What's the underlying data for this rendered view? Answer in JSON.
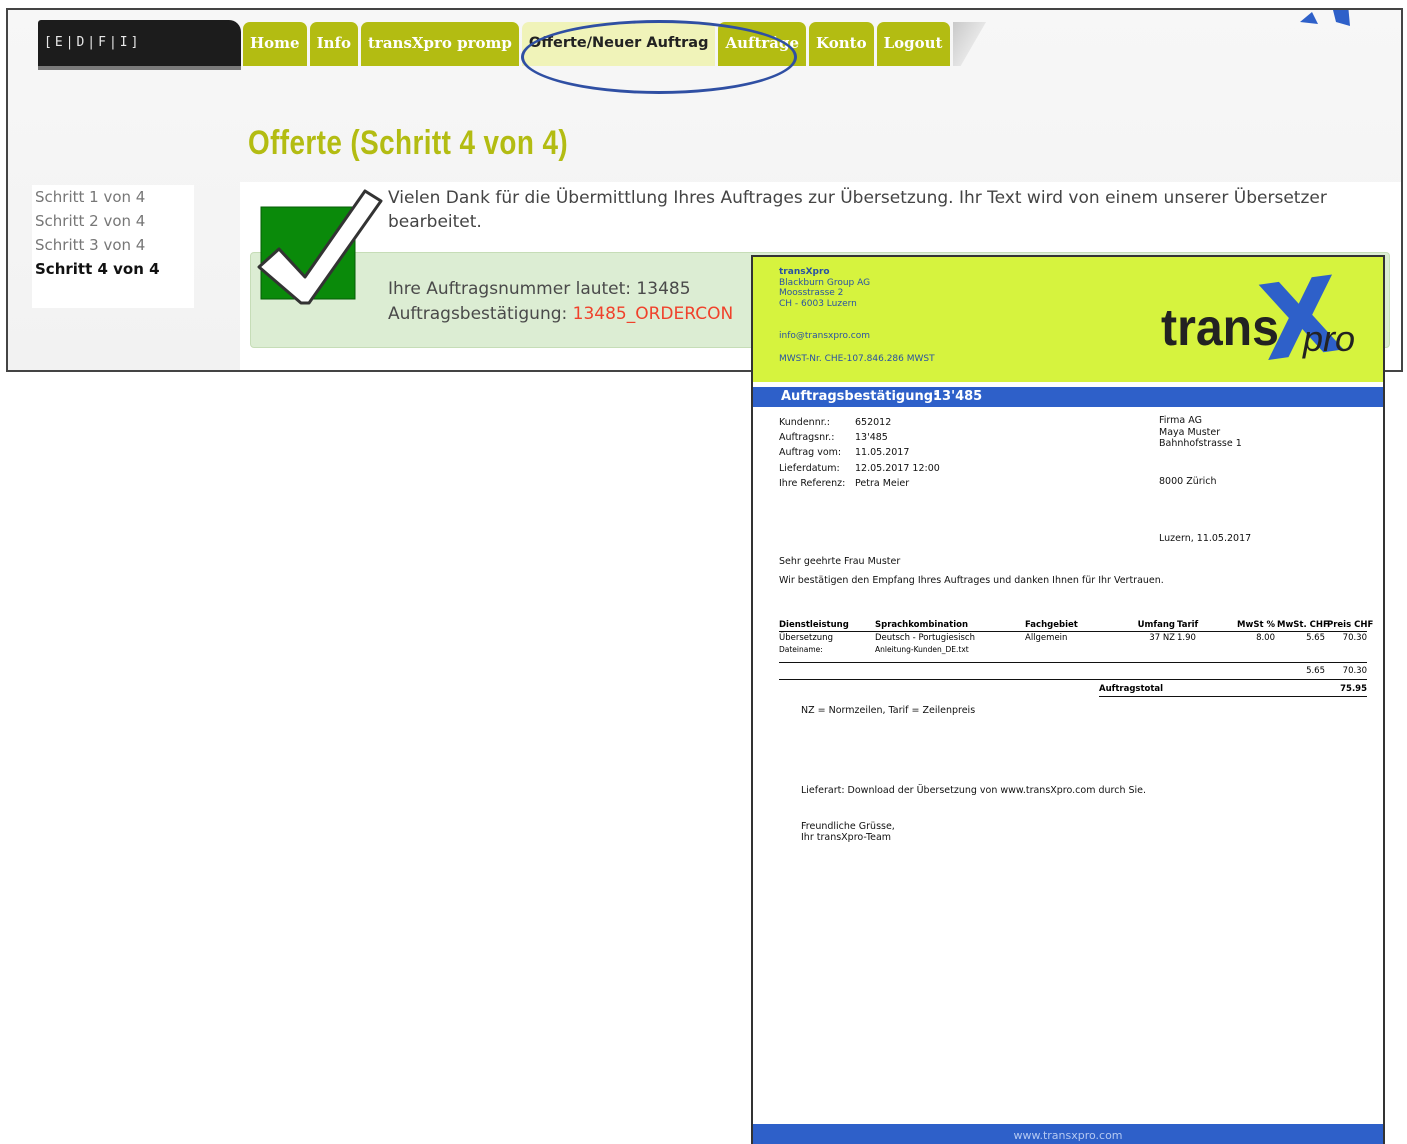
{
  "site": {
    "language_switch": "[E|D|F|I]",
    "nav_tabs": [
      {
        "label": "Home"
      },
      {
        "label": "Info"
      },
      {
        "label": "transXpro promp"
      },
      {
        "label": "Offerte/Neuer Auftrag"
      },
      {
        "label": "Aufträge"
      },
      {
        "label": "Konto"
      },
      {
        "label": "Logout"
      }
    ],
    "active_tab": "Offerte/Neuer Auftrag",
    "page_title": "Offerte (Schritt 4 von 4)",
    "steps": [
      "Schritt 1 von 4",
      "Schritt 2 von 4",
      "Schritt 3 von 4",
      "Schritt 4 von 4"
    ],
    "current_step": "Schritt 4 von 4",
    "thanks_text": "Vielen Dank für die Übermittlung Ihres Auftrages zur Übersetzung. Ihr Text wird von einem unserer Übersetzer bearbeitet.",
    "order_number_text": "Ihre Auftragsnummer lautet: 13485",
    "order_confirmation_label": "Auftragsbestätigung:",
    "order_confirmation_link": "13485_ORDERCON",
    "colors": {
      "brand_green": "#b3bc12",
      "highlight_blue": "#2f4fa3",
      "success_bg": "#dcedd3",
      "link_red": "#f0412b"
    }
  },
  "document": {
    "company_name": "transXpro",
    "company_lines": [
      "Blackburn Group AG",
      "Moosstrasse 2",
      "CH - 6003 Luzern"
    ],
    "email": "info@transxpro.com",
    "vat": "MWST-Nr. CHE-107.846.286 MWST",
    "logo_text_main": "trans",
    "logo_text_x": "X",
    "logo_text_tail": "pro",
    "banner_label": "Auftragsbestätigung:",
    "banner_number": "13'485",
    "meta": [
      {
        "key": "Kundennr.:",
        "value": "652012"
      },
      {
        "key": "Auftragsnr.:",
        "value": "13'485"
      },
      {
        "key": "Auftrag vom:",
        "value": "11.05.2017"
      },
      {
        "key": "Lieferdatum:",
        "value": "12.05.2017 12:00"
      },
      {
        "key": "Ihre Referenz:",
        "value": "Petra Meier"
      }
    ],
    "address": [
      "Firma AG",
      "Maya Muster",
      "Bahnhofstrasse 1"
    ],
    "address_city": "8000 Zürich",
    "place_date": "Luzern, 11.05.2017",
    "greeting": "Sehr geehrte Frau Muster",
    "thanks": "Wir bestätigen den Empfang Ihres Auftrages und danken Ihnen für Ihr Vertrauen.",
    "table_headers": [
      "Dienstleistung",
      "Sprachkombination",
      "Fachgebiet",
      "Umfang",
      "Tarif",
      "MwSt %",
      "MwSt. CHF",
      "Preis CHF"
    ],
    "table_row": [
      "Übersetzung",
      "Deutsch - Portugiesisch",
      "Allgemein",
      "37 NZ",
      "1.90",
      "8.00",
      "5.65",
      "70.30"
    ],
    "file_label": "Dateiname:",
    "file_name": "Anleitung-Kunden_DE.txt",
    "subtotal_vat": "5.65",
    "subtotal_price": "70.30",
    "total_label": "Auftragstotal",
    "total_value": "75.95",
    "legend": "NZ = Normzeilen, Tarif = Zeilenpreis",
    "delivery": "Lieferart: Download der Übersetzung von www.transXpro.com durch Sie.",
    "closing": [
      "Freundliche Grüsse,",
      "Ihr transXpro-Team"
    ],
    "footer": "www.transxpro.com",
    "colors": {
      "header_yellow": "#d6f33e",
      "banner_blue": "#2e60c9",
      "text_blue": "#2951a3"
    }
  }
}
